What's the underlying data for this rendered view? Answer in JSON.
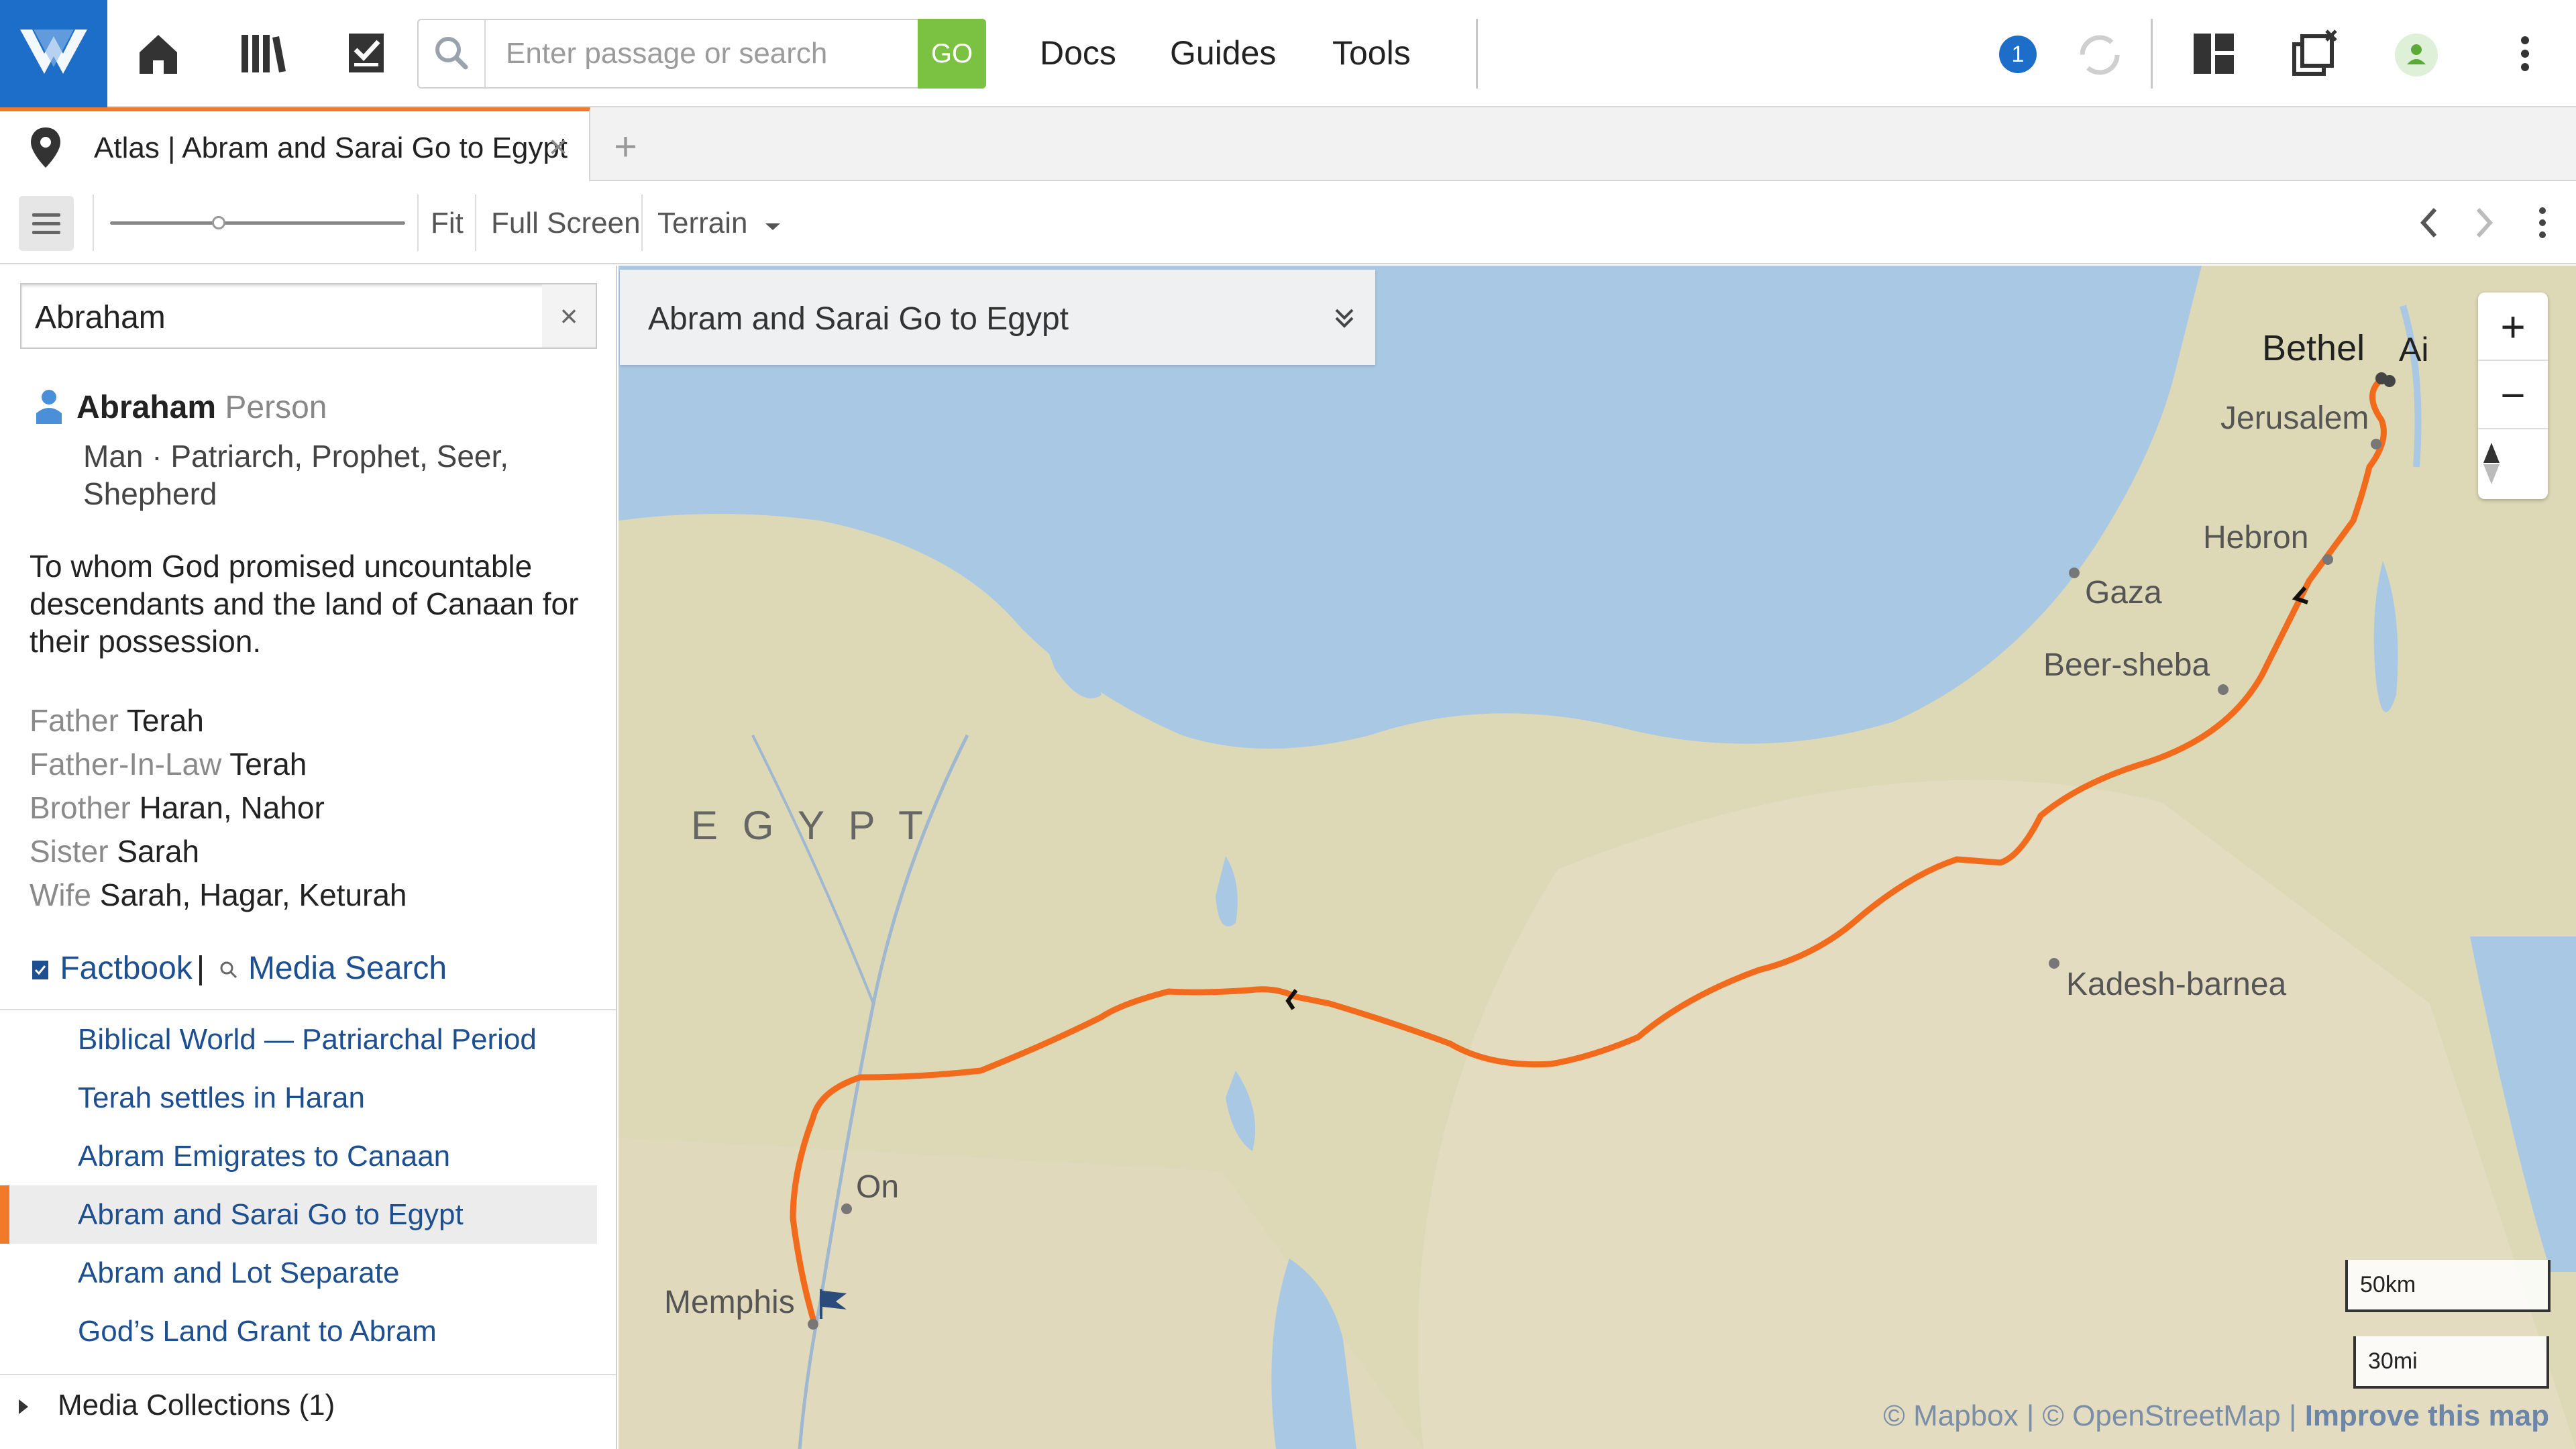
{
  "header": {
    "logo_icon": "app-logo-icon",
    "home_icon": "home-icon",
    "library_icon": "library-icon",
    "tasks_icon": "checklist-icon",
    "search_placeholder": "Enter passage or search",
    "go_label": "GO",
    "nav": [
      "Docs",
      "Guides",
      "Tools"
    ],
    "notification_count": "1",
    "sync_icon": "sync-icon",
    "layout_icon": "layout-icon",
    "send_icon": "send-to-icon",
    "user_icon": "user-icon",
    "more_icon": "more-vertical-icon"
  },
  "tabs": [
    {
      "label": "Atlas | Abram and Sarai Go to Egypt",
      "icon": "map-pin-icon",
      "active": true
    }
  ],
  "toolbar": {
    "fit_label": "Fit",
    "fullscreen_label": "Full Screen",
    "map_style": "Terrain"
  },
  "sidebar": {
    "search_value": "Abraham",
    "person": {
      "name": "Abraham",
      "type": "Person",
      "roles": "Man · Patriarch, Prophet, Seer, Shepherd",
      "summary": "To whom God promised uncountable descendants and the land of Canaan for their possession.",
      "relations": [
        {
          "label": "Father",
          "value": "Terah"
        },
        {
          "label": "Father-In-Law",
          "value": "Terah"
        },
        {
          "label": "Brother",
          "value": "Haran, Nahor"
        },
        {
          "label": "Sister",
          "value": "Sarah"
        },
        {
          "label": "Wife",
          "value": "Sarah, Hagar, Keturah"
        }
      ]
    },
    "links": {
      "factbook": "Factbook",
      "media_search": "Media Search"
    },
    "events": [
      {
        "label": "Biblical World — Patriarchal Period",
        "active": false
      },
      {
        "label": "Terah settles in Haran",
        "active": false
      },
      {
        "label": "Abram Emigrates to Canaan",
        "active": false
      },
      {
        "label": "Abram and Sarai Go to Egypt",
        "active": true
      },
      {
        "label": "Abram and Lot Separate",
        "active": false
      },
      {
        "label": "God’s Land Grant to Abram",
        "active": false
      }
    ],
    "media_collections": "Media Collections (1)"
  },
  "map": {
    "event_title": "Abram and Sarai Go to Egypt",
    "region_label": "E G Y P T",
    "places": [
      "Bethel",
      "Ai",
      "Jerusalem",
      "Hebron",
      "Gaza",
      "Beer-sheba",
      "Kadesh-barnea",
      "On",
      "Memphis"
    ],
    "scale_km": "50km",
    "scale_mi": "30mi",
    "attribution": {
      "mapbox": "© Mapbox",
      "osm": "© OpenStreetMap",
      "improve": "Improve this map",
      "sep": "|"
    },
    "route_color": "#f26b1d",
    "water_color": "#a9c8e3",
    "land_color": "#dcdcb8"
  }
}
